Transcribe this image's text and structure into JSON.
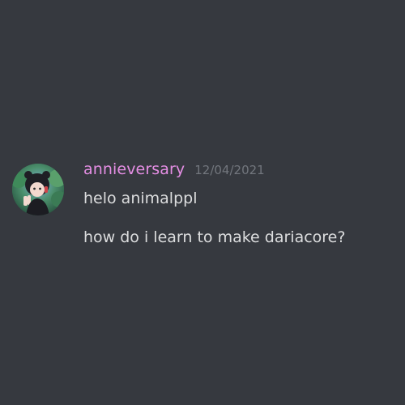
{
  "message": {
    "username": "annieversary",
    "timestamp": "12/04/2021",
    "lines": [
      "helo animalppl",
      "how do i learn to make dariacore?"
    ]
  },
  "colors": {
    "background": "#36393f",
    "username": "#e58ee4",
    "timestamp": "#72767d",
    "text": "#dcddde"
  },
  "icons": {
    "avatar": "anime-character-avatar-icon"
  }
}
